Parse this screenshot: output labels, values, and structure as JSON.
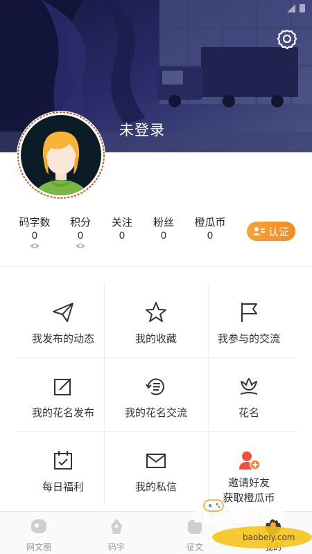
{
  "profile": {
    "login_status": "未登录"
  },
  "stats": [
    {
      "label": "码字数",
      "value": "0",
      "hidden_toggle": true
    },
    {
      "label": "积分",
      "value": "0",
      "hidden_toggle": true
    },
    {
      "label": "关注",
      "value": "0",
      "hidden_toggle": false
    },
    {
      "label": "粉丝",
      "value": "0",
      "hidden_toggle": false
    },
    {
      "label": "橙瓜币",
      "value": "0",
      "hidden_toggle": false
    }
  ],
  "certify_label": "认证",
  "menu": [
    {
      "label": "我发布的动态",
      "icon": "send-icon"
    },
    {
      "label": "我的收藏",
      "icon": "star-icon"
    },
    {
      "label": "我参与的交流",
      "icon": "flag-icon"
    },
    {
      "label": "我的花名发布",
      "icon": "edit-icon"
    },
    {
      "label": "我的花名交流",
      "icon": "exchange-icon"
    },
    {
      "label": "花名",
      "icon": "flower-icon"
    },
    {
      "label": "每日福利",
      "icon": "calendar-icon"
    },
    {
      "label": "我的私信",
      "icon": "mail-icon"
    },
    {
      "label": "邀请好友",
      "label2": "获取橙瓜币",
      "icon": "invite-user-icon"
    }
  ],
  "tabs": [
    {
      "label": "网文圈",
      "icon": "chat-icon",
      "active": false
    },
    {
      "label": "码字",
      "icon": "pen-icon",
      "active": false
    },
    {
      "label": "征文",
      "icon": "contest-icon",
      "active": false
    },
    {
      "label": "我的",
      "icon": "profile-icon",
      "active": true
    }
  ],
  "watermark": {
    "title": "宝贝游戏网",
    "url": "baobeiy.com"
  },
  "colors": {
    "accent": "#f38a1f",
    "invite_icon": "#f2503a",
    "banner_dark": "#1b1d4a"
  }
}
